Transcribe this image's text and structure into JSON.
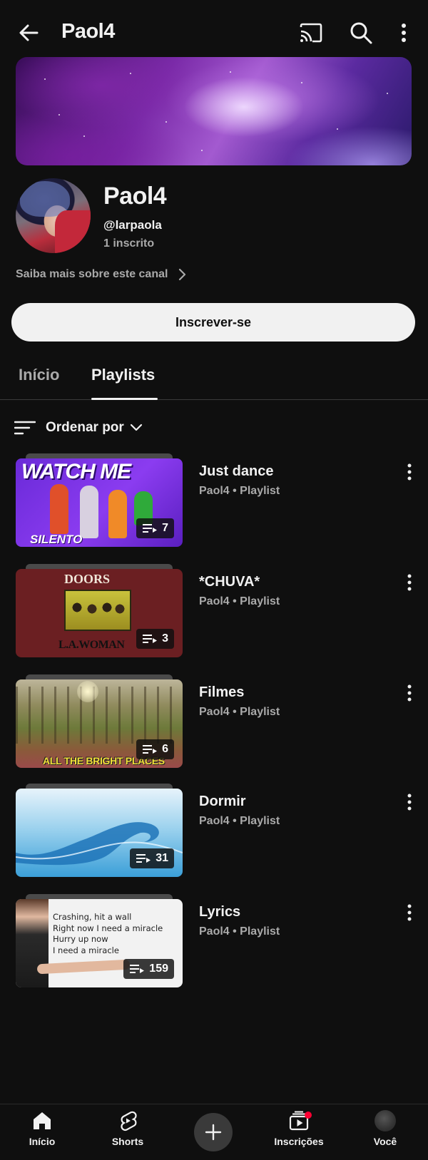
{
  "topbar": {
    "title": "Paol4",
    "icons": [
      "back-arrow-icon",
      "cast-icon",
      "search-icon",
      "more-vert-icon"
    ]
  },
  "channel": {
    "name": "Paol4",
    "handle": "@larpaola",
    "subscribers": "1 inscrito",
    "about_link": "Saiba mais sobre este canal",
    "subscribe_label": "Inscrever-se"
  },
  "tabs": [
    {
      "label": "Início",
      "active": false
    },
    {
      "label": "Playlists",
      "active": true
    }
  ],
  "sort": {
    "label": "Ordenar por"
  },
  "playlists": [
    {
      "title": "Just dance",
      "subtitle": "Paol4 • Playlist",
      "count": "7",
      "thumb": {
        "top_text": "WATCH ME",
        "bottom_text": "SILENTO"
      }
    },
    {
      "title": "*CHUVA*",
      "subtitle": "Paol4 • Playlist",
      "count": "3",
      "thumb": {
        "top_text": "DOORS",
        "bottom_text": "L.A.WOMAN"
      }
    },
    {
      "title": "Filmes",
      "subtitle": "Paol4 • Playlist",
      "count": "6",
      "thumb": {
        "caption": "ALL THE BRIGHT PLACES"
      }
    },
    {
      "title": "Dormir",
      "subtitle": "Paol4 • Playlist",
      "count": "31"
    },
    {
      "title": "Lyrics",
      "subtitle": "Paol4 • Playlist",
      "count": "159",
      "thumb": {
        "lyrics": "Crashing, hit a wall\nRight now I need a miracle\nHurry up now\nI need a miracle"
      }
    }
  ],
  "bottom_nav": [
    {
      "label": "Início",
      "icon": "home-icon"
    },
    {
      "label": "Shorts",
      "icon": "shorts-icon"
    },
    {
      "label": "",
      "icon": "create-plus-icon"
    },
    {
      "label": "Inscrições",
      "icon": "subscriptions-icon"
    },
    {
      "label": "Você",
      "icon": "you-avatar-icon"
    }
  ],
  "colors": {
    "background": "#0f0f0f",
    "text": "#f1f1f1",
    "secondary_text": "#aaaaaa",
    "notification": "#ff0033"
  }
}
